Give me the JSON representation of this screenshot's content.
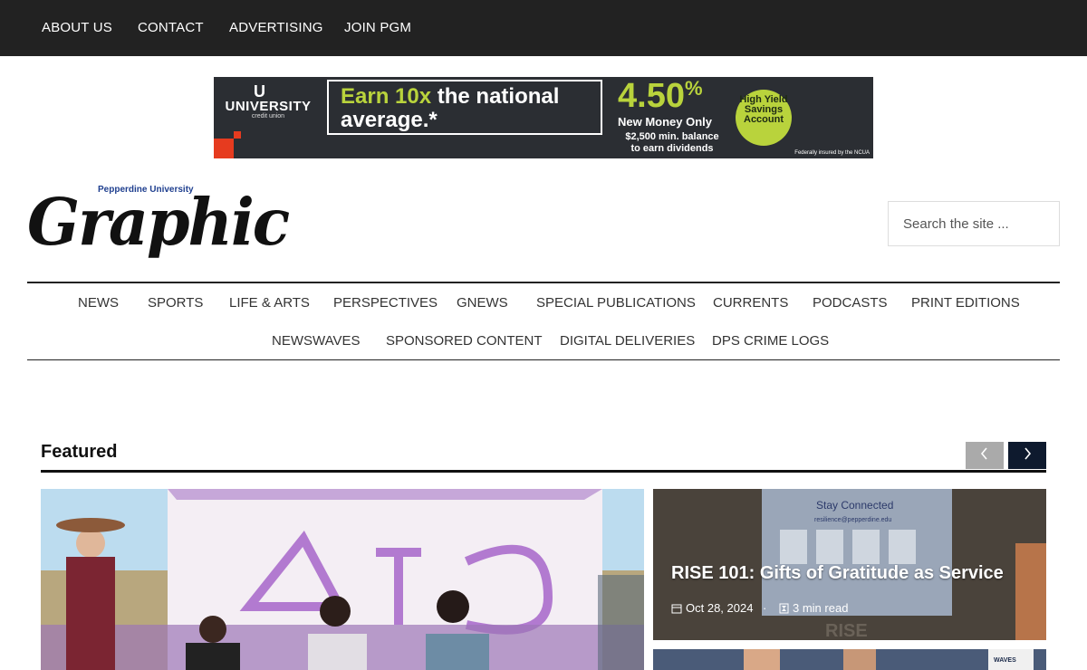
{
  "topbar": {
    "items": [
      "ABOUT US",
      "CONTACT",
      "ADVERTISING",
      "JOIN PGM"
    ]
  },
  "ad": {
    "logo_mark": "U",
    "logo_name": "UNIVERSITY",
    "logo_sub": "credit union",
    "headline_highlight": "Earn 10x",
    "headline_rest": " the national",
    "headline_line2": "average.*",
    "rate": "4.50",
    "rate_unit": "%",
    "new_money": "New Money Only",
    "min_line1": "$2,500 min. balance",
    "min_line2": "to earn dividends",
    "badge": "High Yield Savings Account",
    "fine_print": "Federally insured by the NCUA",
    "accent_color": "#b9d33c"
  },
  "masthead": {
    "university": "Pepperdine University",
    "name": "Graphic"
  },
  "search": {
    "placeholder": "Search the site ..."
  },
  "nav": {
    "row1": [
      "NEWS",
      "SPORTS",
      "LIFE & ARTS",
      "PERSPECTIVES",
      "GNEWS",
      "SPECIAL PUBLICATIONS",
      "CURRENTS",
      "PODCASTS",
      "PRINT EDITIONS"
    ],
    "row2": [
      "NEWSWAVES",
      "SPONSORED CONTENT",
      "DIGITAL DELIVERIES",
      "DPS CRIME LOGS"
    ]
  },
  "featured": {
    "title": "Featured",
    "prev_icon": "chevron-left-icon",
    "next_icon": "chevron-right-icon",
    "side_card": {
      "title": "RISE 101: Gifts of Gratitude as Service",
      "date": "Oct 28, 2024",
      "read_time": "3 min read",
      "screen_heading": "Stay Connected",
      "screen_email": "resilience@pepperdine.edu",
      "screen_footer": "RISE"
    },
    "main_photo": {
      "tent_letters": "ΑΤΔ"
    },
    "second_card": {
      "jersey_text": "WAVES"
    }
  }
}
